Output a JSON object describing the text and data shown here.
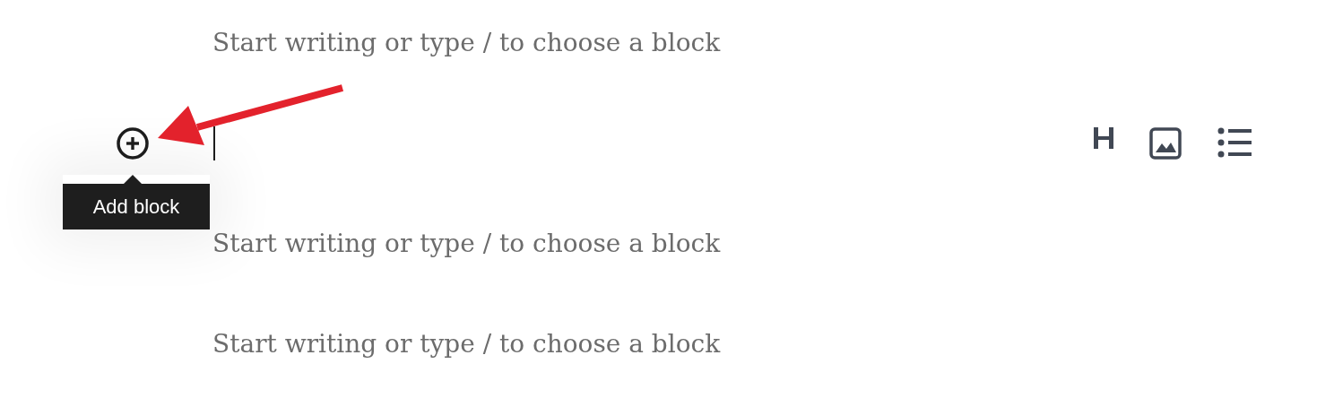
{
  "blocks": [
    {
      "kind": "placeholder",
      "placeholder": "Start writing or type / to choose a block"
    },
    {
      "kind": "active",
      "tooltip": "Add block"
    },
    {
      "kind": "placeholder",
      "placeholder": "Start writing or type / to choose a block"
    },
    {
      "kind": "placeholder",
      "placeholder": "Start writing or type / to choose a block"
    }
  ]
}
